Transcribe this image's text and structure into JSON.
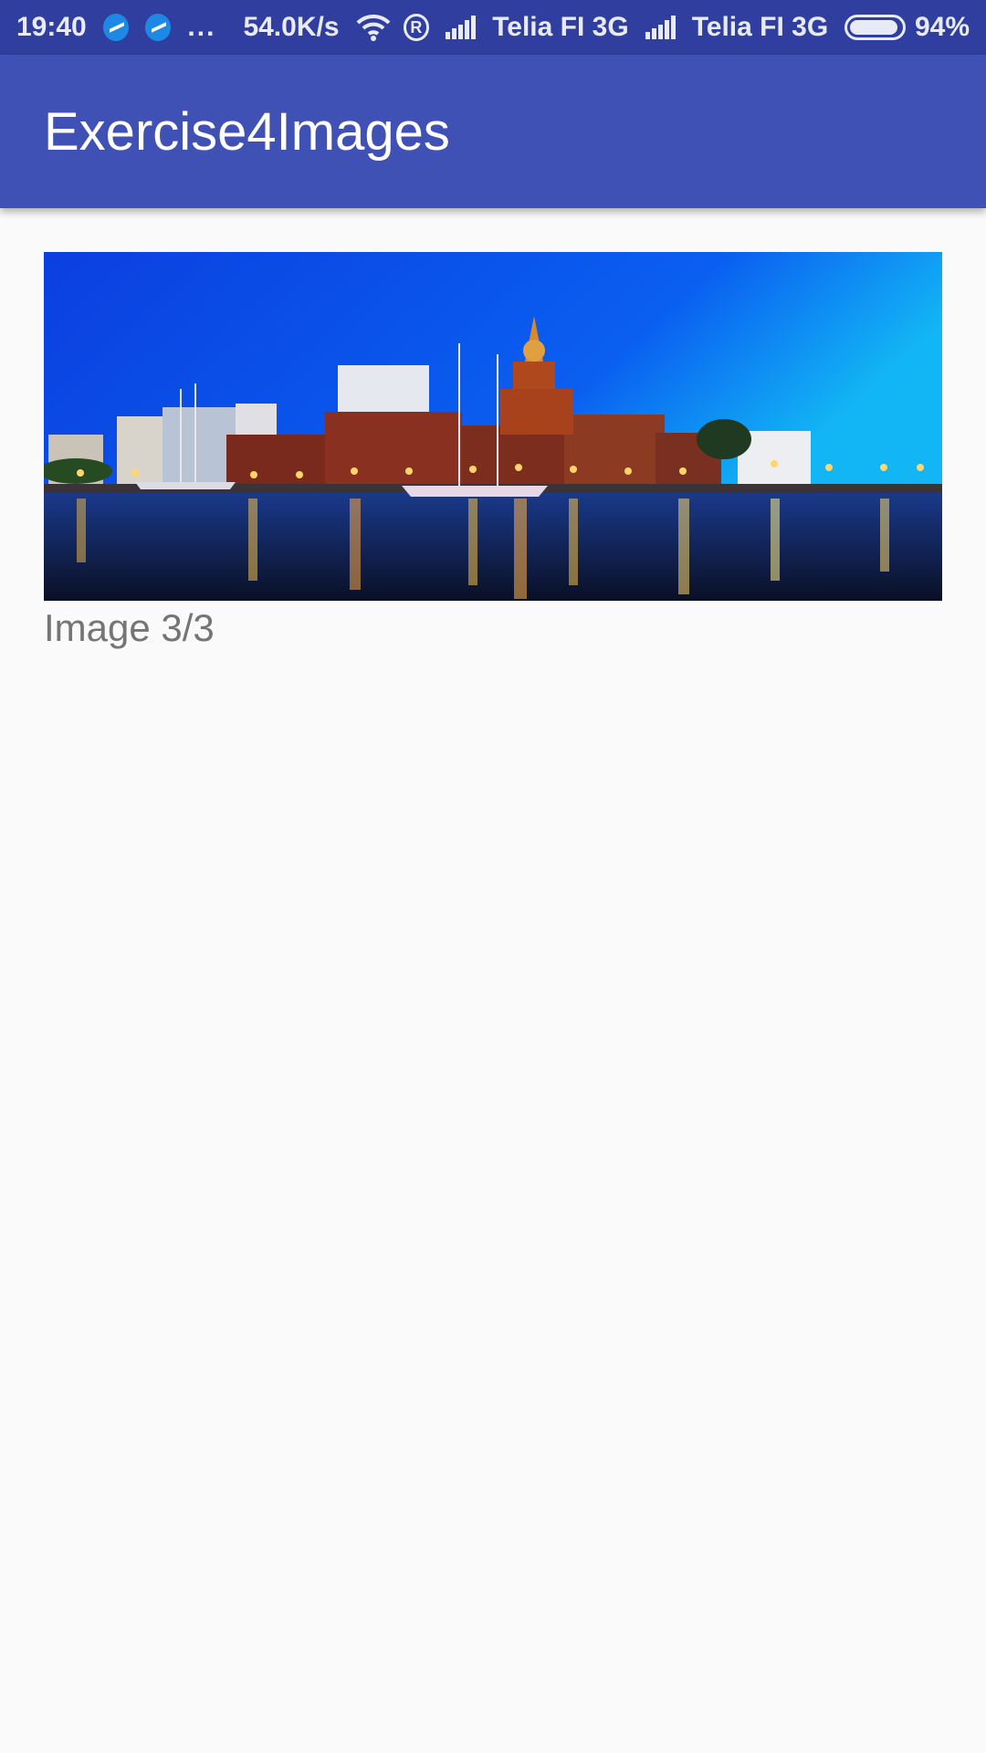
{
  "status_bar": {
    "time": "19:40",
    "dots": "...",
    "speed": "54.0K/s",
    "registered_mark": "R",
    "carrier_1": "Telia FI 3G",
    "carrier_2": "Telia FI 3G",
    "battery": "94%",
    "battery_level": 0.94,
    "icons": [
      "messenger-icon",
      "messenger-icon",
      "wifi-icon",
      "registered-icon",
      "signal-icon",
      "signal-icon",
      "battery-icon"
    ]
  },
  "app_bar": {
    "title": "Exercise4Images"
  },
  "main": {
    "image_alt_icon": "photo-harbour-night",
    "caption": "Image 3/3"
  },
  "colors": {
    "status_bar": "#303f9f",
    "app_bar": "#3f51b5",
    "background": "#fafafa",
    "caption_text": "#757575"
  }
}
